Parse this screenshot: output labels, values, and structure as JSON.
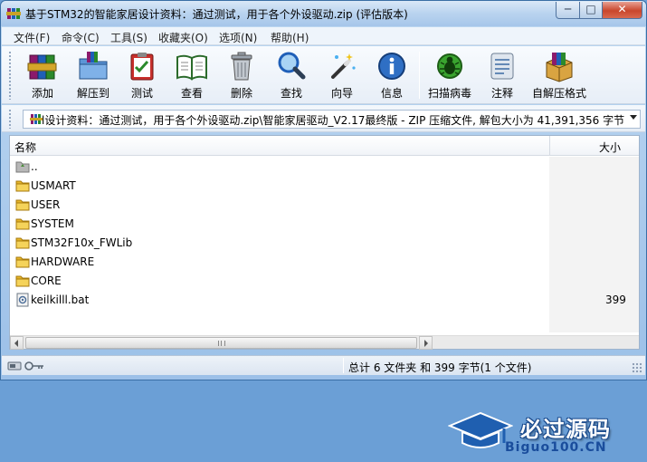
{
  "window": {
    "title": "基于STM32的智能家居设计资料：通过测试，用于各个外设驱动.zip (评估版本)",
    "min_glyph": "─",
    "max_glyph": "□",
    "close_glyph": "✕"
  },
  "menu": [
    {
      "label": "文件(F)"
    },
    {
      "label": "命令(C)"
    },
    {
      "label": "工具(S)"
    },
    {
      "label": "收藏夹(O)"
    },
    {
      "label": "选项(N)"
    },
    {
      "label": "帮助(H)"
    }
  ],
  "toolbar": [
    {
      "label": "添加",
      "icon": "add-books-icon"
    },
    {
      "label": "解压到",
      "icon": "extract-folder-icon"
    },
    {
      "label": "测试",
      "icon": "test-clipboard-icon"
    },
    {
      "label": "查看",
      "icon": "view-book-icon"
    },
    {
      "label": "删除",
      "icon": "trash-icon"
    },
    {
      "label": "查找",
      "icon": "magnifier-icon"
    },
    {
      "label": "向导",
      "icon": "wizard-wand-icon"
    },
    {
      "label": "信息",
      "icon": "info-icon"
    },
    {
      "label": "扫描病毒",
      "icon": "virus-bug-icon"
    },
    {
      "label": "注释",
      "icon": "comment-icon"
    },
    {
      "label": "自解压格式",
      "icon": "sfx-box-icon"
    }
  ],
  "address": {
    "path": "l设计资料：通过测试，用于各个外设驱动.zip\\智能家居驱动_V2.17最终版 - ZIP 压缩文件, 解包大小为 41,391,356 字节"
  },
  "columns": {
    "name": "名称",
    "size": "大小"
  },
  "files": [
    {
      "name": "..",
      "type": "parent",
      "size": ""
    },
    {
      "name": "USMART",
      "type": "folder",
      "size": ""
    },
    {
      "name": "USER",
      "type": "folder",
      "size": ""
    },
    {
      "name": "SYSTEM",
      "type": "folder",
      "size": ""
    },
    {
      "name": "STM32F10x_FWLib",
      "type": "folder",
      "size": ""
    },
    {
      "name": "HARDWARE",
      "type": "folder",
      "size": ""
    },
    {
      "name": "CORE",
      "type": "folder",
      "size": ""
    },
    {
      "name": "keilkilll.bat",
      "type": "bat",
      "size": "399"
    }
  ],
  "watermark": {
    "title": "必过源码",
    "subtitle": "Biguo100.CN"
  },
  "status": {
    "text": "总计 6 文件夹 和 399 字节(1 个文件)"
  },
  "colors": {
    "folder": "#f0c419",
    "accent": "#3a6ea5"
  }
}
